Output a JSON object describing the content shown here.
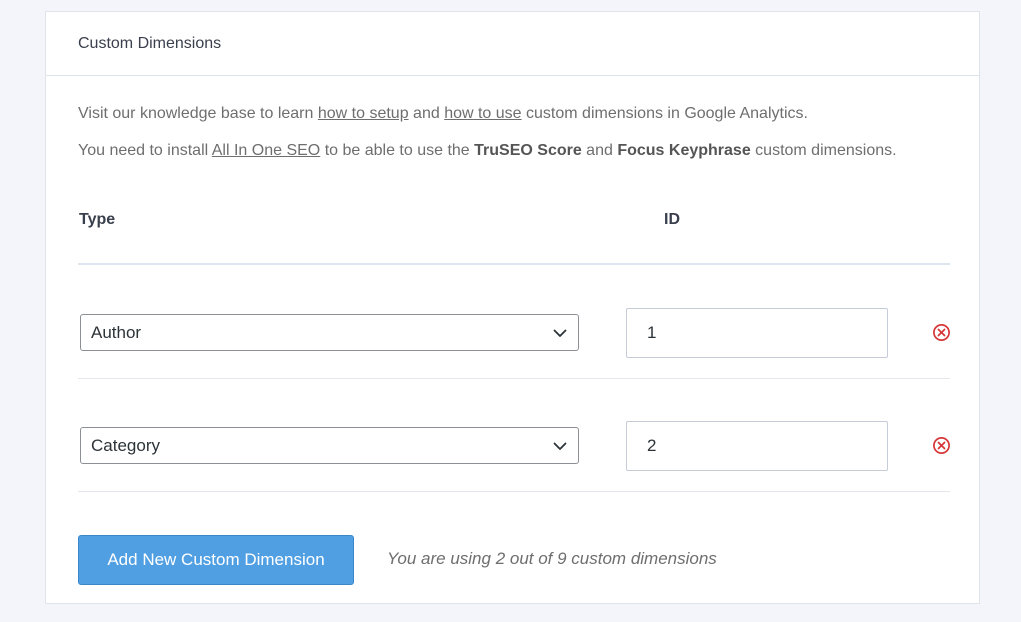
{
  "panel": {
    "title": "Custom Dimensions"
  },
  "intro": {
    "p1_before": "Visit our knowledge base to learn ",
    "p1_link1": "how to setup",
    "p1_middle": " and ",
    "p1_link2": "how to use",
    "p1_after": " custom dimensions in Google Analytics.",
    "p2_before": "You need to install ",
    "p2_link": "All In One SEO",
    "p2_middle": " to be able to use the ",
    "p2_bold1": "TruSEO Score",
    "p2_and": " and ",
    "p2_bold2": "Focus Keyphrase",
    "p2_after": " custom dimensions."
  },
  "table": {
    "col_type": "Type",
    "col_id": "ID",
    "rows": [
      {
        "type": "Author",
        "id": "1"
      },
      {
        "type": "Category",
        "id": "2"
      }
    ]
  },
  "actions": {
    "add_label": "Add New Custom Dimension",
    "usage_note": "You are using 2 out of 9 custom dimensions"
  },
  "icons": {
    "dropdown": "chevron-down-icon",
    "remove": "remove-circle-x-icon"
  },
  "colors": {
    "accent_button": "#509fe2",
    "remove_icon": "#d63638"
  }
}
